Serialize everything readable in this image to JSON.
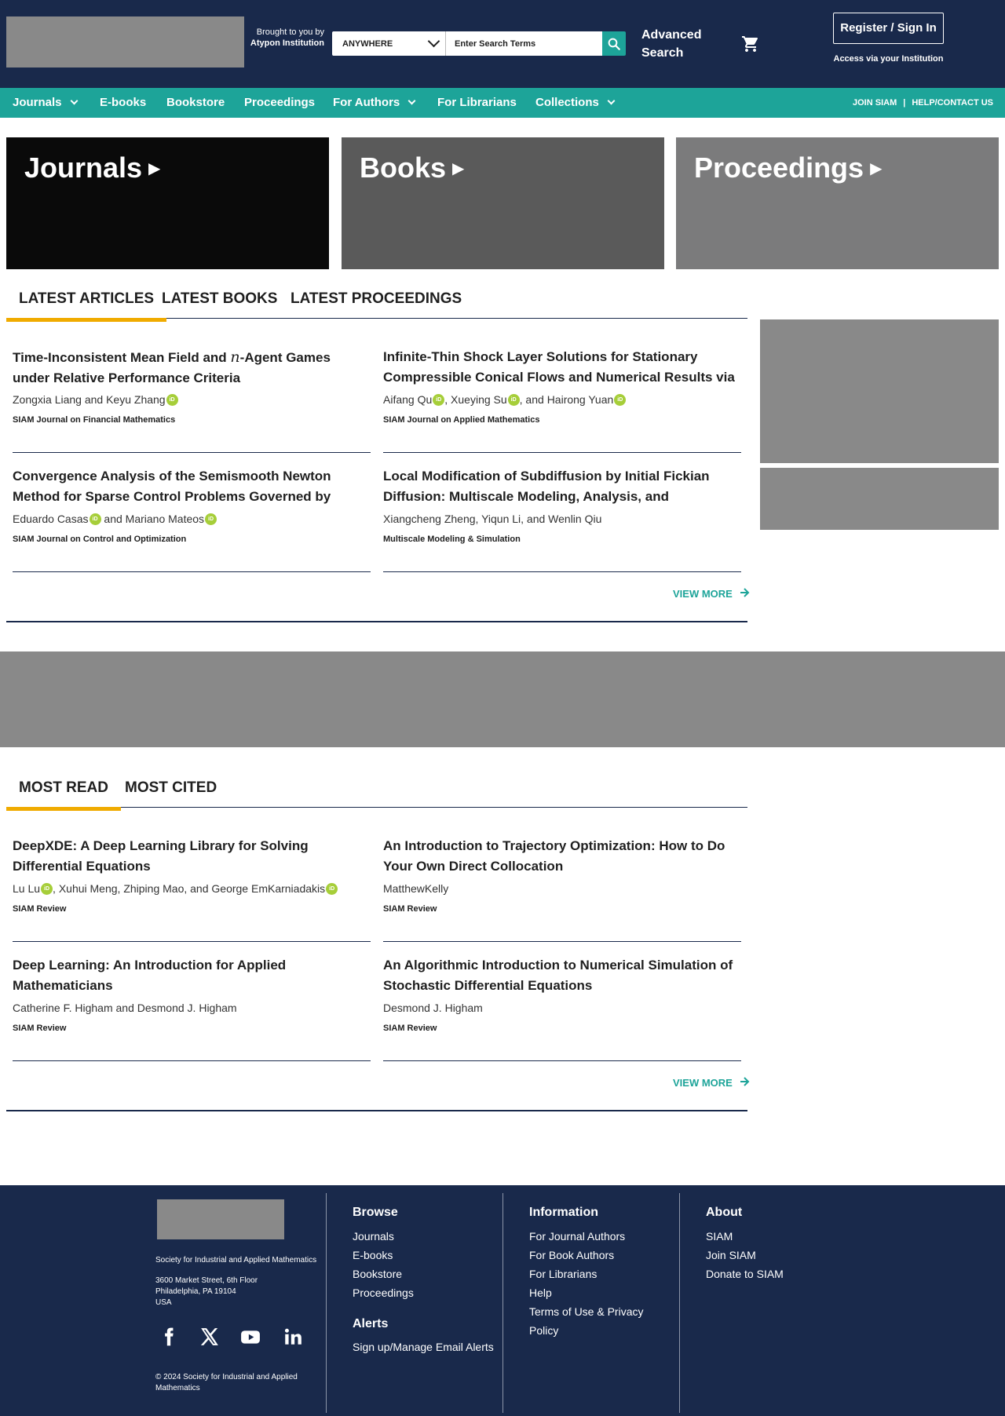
{
  "header": {
    "brought_by_prefix": "Brought to you by",
    "brought_by_institution": "Atypon Institution",
    "search_scope": "ANYWHERE",
    "search_placeholder": "Enter Search Terms",
    "advanced_search": "Advanced Search",
    "register_sign_in": "Register / Sign In",
    "access_institution": "Access via your Institution"
  },
  "nav": {
    "items": [
      {
        "label": "Journals",
        "dropdown": true
      },
      {
        "label": "E-books",
        "dropdown": false
      },
      {
        "label": "Bookstore",
        "dropdown": false
      },
      {
        "label": "Proceedings",
        "dropdown": false
      },
      {
        "label": "For Authors",
        "dropdown": true
      },
      {
        "label": "For Librarians",
        "dropdown": false
      },
      {
        "label": "Collections",
        "dropdown": true
      }
    ],
    "join": "JOIN SIAM",
    "separator": "|",
    "help": "HELP/CONTACT US"
  },
  "tiles": [
    {
      "label": "Journals",
      "color": "#0a0a0a"
    },
    {
      "label": "Books",
      "color": "#5a5a5a"
    },
    {
      "label": "Proceedings",
      "color": "#7b7b7c"
    }
  ],
  "latest": {
    "tabs": [
      "LATEST ARTICLES",
      "LATEST BOOKS",
      "LATEST PROCEEDINGS"
    ],
    "active_tab": 0,
    "articles": [
      {
        "title_before": "Time-Inconsistent Mean Field and ",
        "title_math": "n",
        "title_after": "-Agent Games under Relative Performance Criteria",
        "authors": [
          {
            "name": "Zongxia Liang and Keyu Zhang",
            "orcid": true
          }
        ],
        "journal": "SIAM Journal on Financial Mathematics"
      },
      {
        "title": "Infinite-Thin Shock Layer Solutions for Stationary Compressible Conical Flows and Numerical Results via",
        "authors": [
          {
            "name": "Aifang Qu",
            "orcid": true,
            "sep": ", "
          },
          {
            "name": "Xueying Su",
            "orcid": true,
            "sep": ", and "
          },
          {
            "name": "Hairong Yuan",
            "orcid": true
          }
        ],
        "journal": "SIAM Journal on Applied Mathematics"
      },
      {
        "title": "Convergence Analysis of the Semismooth Newton Method for Sparse Control Problems Governed by Semilinear",
        "authors": [
          {
            "name": "Eduardo Casas",
            "orcid": true,
            "sep": " and "
          },
          {
            "name": "Mariano Mateos",
            "orcid": true
          }
        ],
        "journal": "SIAM Journal on Control and Optimization"
      },
      {
        "title": "Local Modification of Subdiffusion by Initial Fickian Diffusion: Multiscale Modeling, Analysis, and Computation",
        "authors": [
          {
            "name": "Xiangcheng Zheng, Yiqun Li, and Wenlin Qiu",
            "orcid": false
          }
        ],
        "journal": "Multiscale Modeling & Simulation"
      }
    ],
    "view_more": "VIEW MORE"
  },
  "most": {
    "tabs": [
      "MOST READ",
      "MOST CITED"
    ],
    "active_tab": 0,
    "articles": [
      {
        "title": "DeepXDE: A Deep Learning Library for Solving Differential Equations",
        "authors": [
          {
            "name": "Lu Lu",
            "orcid": true,
            "sep": ", "
          },
          {
            "name": "Xuhui Meng, Zhiping Mao, and George EmKarniadakis",
            "orcid": true
          }
        ],
        "journal": "SIAM Review"
      },
      {
        "title": "An Introduction to Trajectory Optimization: How to Do Your Own Direct Collocation",
        "authors": [
          {
            "name": "MatthewKelly",
            "orcid": false
          }
        ],
        "journal": "SIAM Review"
      },
      {
        "title": "Deep Learning: An Introduction for Applied Mathematicians",
        "authors": [
          {
            "name": "Catherine F. Higham and Desmond J. Higham",
            "orcid": false
          }
        ],
        "journal": "SIAM Review"
      },
      {
        "title": "An Algorithmic Introduction to Numerical Simulation of Stochastic Differential Equations",
        "authors": [
          {
            "name": "Desmond J. Higham",
            "orcid": false
          }
        ],
        "journal": "SIAM Review"
      }
    ],
    "view_more": "VIEW MORE"
  },
  "footer": {
    "org": "Society for Industrial and Applied Mathematics",
    "address": [
      "3600 Market Street, 6th Floor",
      "Philadelphia, PA 19104",
      "USA"
    ],
    "social_icons": [
      "facebook-icon",
      "x-icon",
      "youtube-icon",
      "linkedin-icon"
    ],
    "copyright": "© 2024 Society for Industrial and Applied Mathematics",
    "browse_heading": "Browse",
    "browse": [
      "Journals",
      "E-books",
      "Bookstore",
      "Proceedings"
    ],
    "alerts_heading": "Alerts",
    "alerts": [
      "Sign up/Manage Email Alerts"
    ],
    "information_heading": "Information",
    "information": [
      "For Journal Authors",
      "For Book Authors",
      "For Librarians",
      "Help",
      "Terms of Use & Privacy Policy"
    ],
    "about_heading": "About",
    "about": [
      "SIAM",
      "Join SIAM",
      "Donate to SIAM"
    ]
  },
  "colors": {
    "header_bg": "#19294b",
    "accent_teal": "#1da499",
    "tab_underline": "#f0ab00",
    "orcid_green": "#a6ce39",
    "placeholder_gray": "#898989"
  }
}
